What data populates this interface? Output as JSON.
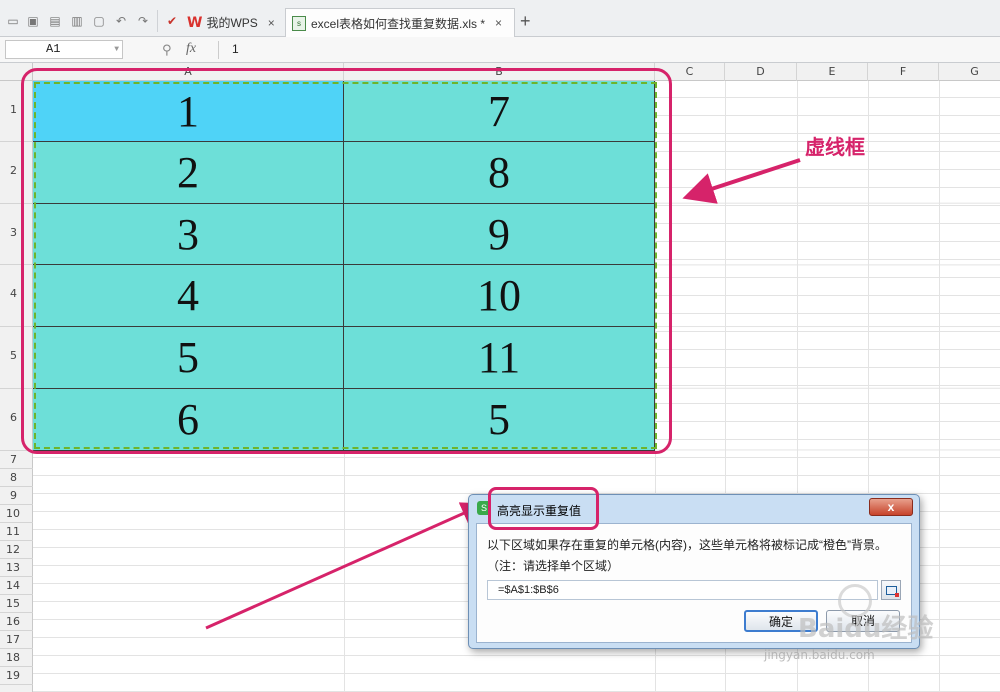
{
  "tabs": {
    "wps_label": "我的WPS",
    "file_label": "excel表格如何查找重复数据.xls *",
    "close_glyph": "×",
    "new_tab_glyph": "+"
  },
  "quick_access_icons": [
    "folder-icon",
    "save-icon",
    "export-pdf-icon",
    "print-icon",
    "print-preview-icon",
    "undo-icon",
    "redo-icon",
    "format-painter-icon"
  ],
  "formula_bar": {
    "name_box": "A1",
    "fx_label": "fx",
    "value": "1"
  },
  "columns": [
    "A",
    "B",
    "C",
    "D",
    "E",
    "F",
    "G"
  ],
  "rows": [
    "1",
    "2",
    "3",
    "4",
    "5",
    "6",
    "7",
    "8",
    "9",
    "10",
    "11",
    "12",
    "13",
    "14",
    "15",
    "16",
    "17",
    "18",
    "19"
  ],
  "cells": {
    "col_a": [
      "1",
      "2",
      "3",
      "4",
      "5",
      "6"
    ],
    "col_b": [
      "7",
      "8",
      "9",
      "10",
      "11",
      "5"
    ]
  },
  "annotation": {
    "label": "虚线框",
    "color": "#d6236a"
  },
  "dialog": {
    "title": "高亮显示重复值",
    "close_glyph": "x",
    "description": "以下区域如果存在重复的单元格(内容)，这些单元格将被标记成“橙色”背景。",
    "note": "（注：请选择单个区域）",
    "range_value": "=$A$1:$B$6",
    "ok_label": "确定",
    "cancel_label": "取消"
  },
  "watermark": {
    "main": "Baidu经验",
    "url": "jingyan.baidu.com"
  },
  "colors": {
    "cell_fill": "#6ddfd8",
    "selected_fill": "#4fd3f7",
    "marching_ants": "#6eb42b"
  }
}
